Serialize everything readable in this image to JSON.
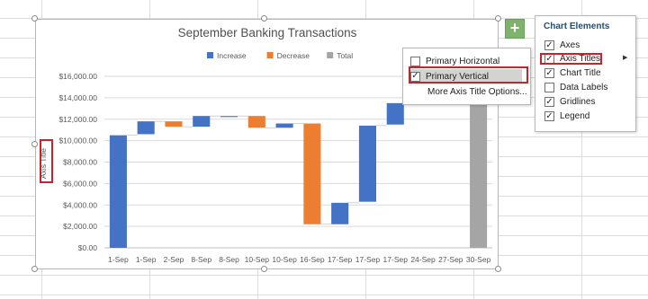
{
  "chart_data": {
    "type": "bar",
    "subtype": "waterfall",
    "title": "September Banking Transactions",
    "ylabel": "Axis Title",
    "xlabel": "",
    "ylim": [
      0,
      16000
    ],
    "yticks": [
      "$0.00",
      "$2,000.00",
      "$4,000.00",
      "$6,000.00",
      "$8,000.00",
      "$10,000.00",
      "$12,000.00",
      "$14,000.00",
      "$16,000.00"
    ],
    "grid": true,
    "legend_position": "top",
    "legend": [
      {
        "name": "Increase",
        "color": "#4472c4"
      },
      {
        "name": "Decrease",
        "color": "#ed7d31"
      },
      {
        "name": "Total",
        "color": "#a5a5a5"
      }
    ],
    "categories": [
      "1-Sep",
      "1-Sep",
      "2-Sep",
      "8-Sep",
      "8-Sep",
      "10-Sep",
      "10-Sep",
      "16-Sep",
      "17-Sep",
      "17-Sep",
      "17-Sep",
      "24-Sep",
      "27-Sep",
      "30-Sep"
    ],
    "bars": [
      {
        "kind": "Increase",
        "start": 0,
        "end": 10500
      },
      {
        "kind": "Increase",
        "start": 10600,
        "end": 11800
      },
      {
        "kind": "Decrease",
        "start": 11800,
        "end": 11300
      },
      {
        "kind": "Increase",
        "start": 11300,
        "end": 12300
      },
      {
        "kind": "Increase",
        "start": 12200,
        "end": 12300
      },
      {
        "kind": "Decrease",
        "start": 12300,
        "end": 11200
      },
      {
        "kind": "Increase",
        "start": 11200,
        "end": 11600
      },
      {
        "kind": "Decrease",
        "start": 11600,
        "end": 2200
      },
      {
        "kind": "Increase",
        "start": 2200,
        "end": 4200
      },
      {
        "kind": "Increase",
        "start": 4300,
        "end": 11400
      },
      {
        "kind": "Increase",
        "start": 11500,
        "end": 13500
      },
      {
        "kind": "Increase",
        "start": 13500,
        "end": 13500
      },
      {
        "kind": "Increase",
        "start": 13500,
        "end": 13500
      },
      {
        "kind": "Total",
        "start": 0,
        "end": 13500
      }
    ]
  },
  "chart_elements_button": {
    "symbol": "+"
  },
  "axis_titles_submenu": {
    "items": [
      {
        "label": "Primary Horizontal",
        "checked": false
      },
      {
        "label": "Primary Vertical",
        "checked": true
      },
      {
        "label": "More Axis Title Options...",
        "checked": null
      }
    ]
  },
  "chart_elements_panel": {
    "title": "Chart Elements",
    "items": [
      {
        "label": "Axes",
        "checked": true
      },
      {
        "label": "Axis Titles",
        "checked": true
      },
      {
        "label": "Chart Title",
        "checked": true
      },
      {
        "label": "Data Labels",
        "checked": false
      },
      {
        "label": "Gridlines",
        "checked": true
      },
      {
        "label": "Legend",
        "checked": true
      }
    ],
    "submenu_arrow": "▶"
  },
  "colors": {
    "increase": "#4472c4",
    "decrease": "#ed7d31",
    "total": "#a5a5a5",
    "highlight_box": "#c0272d",
    "panel_title": "#1f4e78"
  }
}
